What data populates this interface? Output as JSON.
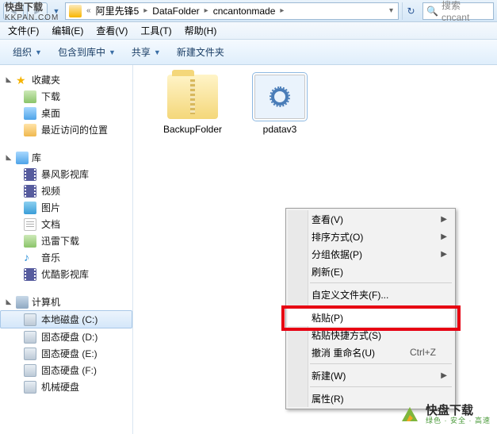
{
  "breadcrumb": {
    "seg1": "阿里先锋5",
    "seg2": "DataFolder",
    "seg3": "cncantonmade"
  },
  "search": {
    "placeholder": "搜索 cncant"
  },
  "menu": {
    "file": "文件(F)",
    "edit": "编辑(E)",
    "view": "查看(V)",
    "tools": "工具(T)",
    "help": "帮助(H)"
  },
  "toolbar": {
    "organize": "组织",
    "include": "包含到库中",
    "share": "共享",
    "newfolder": "新建文件夹"
  },
  "sidebar": {
    "fav": "收藏夹",
    "downloads": "下载",
    "desktop": "桌面",
    "recent": "最近访问的位置",
    "lib": "库",
    "vid1": "暴风影视库",
    "vid2": "视频",
    "pic": "图片",
    "doc": "文档",
    "xl": "迅雷下载",
    "music": "音乐",
    "youku": "优酷影视库",
    "pc": "计算机",
    "c": "本地磁盘 (C:)",
    "d": "固态硬盘 (D:)",
    "e": "固态硬盘 (E:)",
    "f": "固态硬盘 (F:)",
    "g": "机械硬盘"
  },
  "files": {
    "f1": "BackupFolder",
    "f2": "pdatav3"
  },
  "ctx": {
    "view": "查看(V)",
    "sort": "排序方式(O)",
    "group": "分组依据(P)",
    "refresh": "刷新(E)",
    "custom": "自定义文件夹(F)...",
    "paste": "粘贴(P)",
    "pasteShortcut": "粘贴快捷方式(S)",
    "undo": "撤消 重命名(U)",
    "undo_sc": "Ctrl+Z",
    "new": "新建(W)",
    "prop": "属性(R)"
  },
  "wm1": {
    "line1": "快盘下载",
    "line2": "KKPAN.COM"
  },
  "wm2": {
    "line1": "快盘下载",
    "line2": "绿色 · 安全 · 高速"
  }
}
